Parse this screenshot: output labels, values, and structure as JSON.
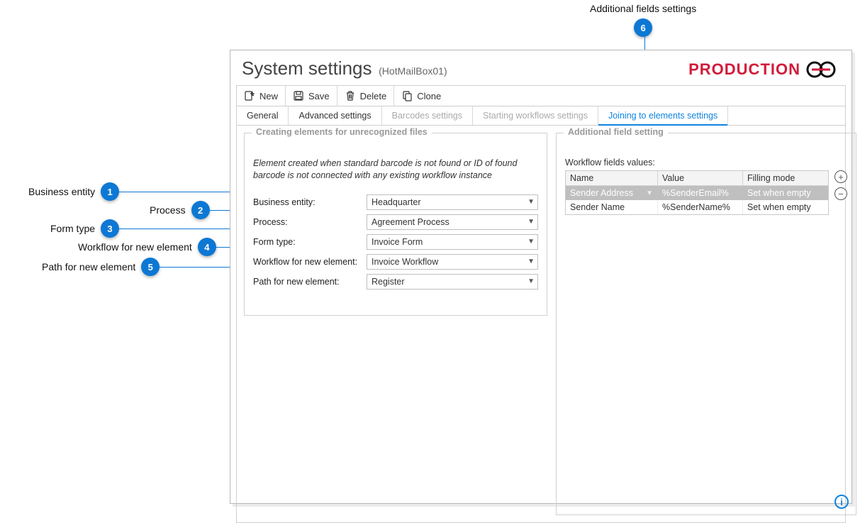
{
  "callouts": {
    "c1": "Business entity",
    "c2": "Process",
    "c3": "Form type",
    "c4": "Workflow for new element",
    "c5": "Path for new element",
    "c6": "Additional fields settings",
    "n1": "1",
    "n2": "2",
    "n3": "3",
    "n4": "4",
    "n5": "5",
    "n6": "6"
  },
  "header": {
    "title": "System settings",
    "subtitle": "(HotMailBox01)",
    "environment": "PRODUCTION"
  },
  "toolbar": {
    "new": "New",
    "save": "Save",
    "delete": "Delete",
    "clone": "Clone"
  },
  "tabs": {
    "general": "General",
    "advanced": "Advanced settings",
    "barcodes": "Barcodes settings",
    "starting": "Starting workflows settings",
    "joining": "Joining to elements settings"
  },
  "left_panel": {
    "title": "Creating elements for unrecognized files",
    "desc": "Element created when standard barcode is not found or ID of found barcode  is not connected with any existing workflow instance",
    "fields": {
      "business_entity": {
        "label": "Business entity:",
        "value": "Headquarter"
      },
      "process": {
        "label": "Process:",
        "value": "Agreement Process"
      },
      "form_type": {
        "label": "Form type:",
        "value": "Invoice Form"
      },
      "workflow": {
        "label": "Workflow for new element:",
        "value": "Invoice Workflow"
      },
      "path": {
        "label": "Path for new element:",
        "value": "Register"
      }
    }
  },
  "right_panel": {
    "title": "Additional field setting",
    "list_label": "Workflow fields values:",
    "headers": {
      "name": "Name",
      "value": "Value",
      "filling": "Filling mode"
    },
    "rows": [
      {
        "name": "Sender Address",
        "value": "%SenderEmail%",
        "filling": "Set when empty"
      },
      {
        "name": "Sender Name",
        "value": "%SenderName%",
        "filling": "Set when empty"
      }
    ],
    "add": "+",
    "remove": "−"
  }
}
